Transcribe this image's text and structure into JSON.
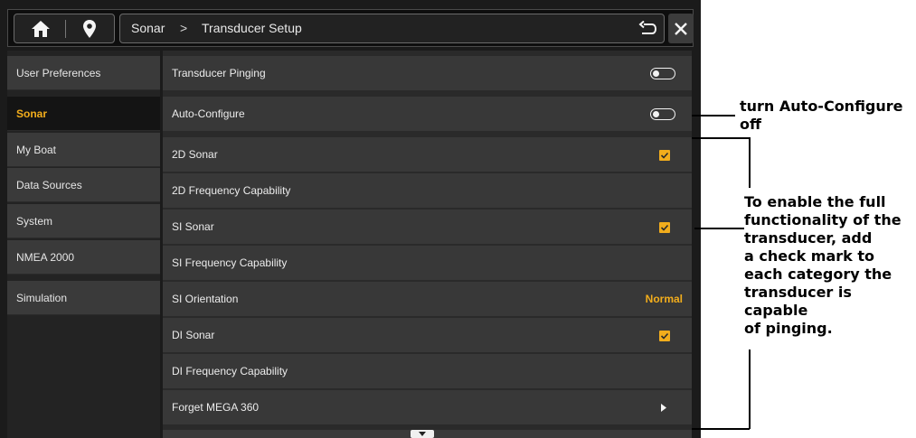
{
  "breadcrumb": {
    "root": "Sonar",
    "separator": ">",
    "current": "Transducer Setup"
  },
  "sidebar": {
    "items": [
      {
        "label": "User Preferences"
      },
      {
        "label": "Sonar",
        "selected": true
      },
      {
        "label": "My Boat"
      },
      {
        "label": "Data Sources"
      },
      {
        "label": "System"
      },
      {
        "label": "NMEA 2000"
      },
      {
        "label": "Simulation"
      }
    ]
  },
  "settings": {
    "rows": [
      {
        "label": "Transducer Pinging",
        "control": "toggle",
        "on": false
      },
      {
        "label": "Auto-Configure",
        "control": "toggle",
        "on": false
      },
      {
        "label": "2D Sonar",
        "control": "checkbox",
        "checked": true
      },
      {
        "label": "2D Frequency Capability",
        "control": "none"
      },
      {
        "label": "SI Sonar",
        "control": "checkbox",
        "checked": true
      },
      {
        "label": "SI Frequency Capability",
        "control": "none"
      },
      {
        "label": "SI Orientation",
        "control": "value",
        "value": "Normal"
      },
      {
        "label": "DI Sonar",
        "control": "checkbox",
        "checked": true
      },
      {
        "label": "DI Frequency Capability",
        "control": "none"
      },
      {
        "label": "Forget MEGA 360",
        "control": "submenu"
      }
    ]
  },
  "annotations": {
    "auto_configure_line1": "turn Auto-Configure",
    "auto_configure_line2": "off",
    "enable_lines": [
      "To enable the full",
      "functionality of the",
      "transducer, add",
      "a check mark to",
      "each category the",
      "transducer is capable",
      "of pinging."
    ]
  },
  "icons": {
    "home": "home-icon",
    "location": "map-pin-icon",
    "back": "back-arrow-icon",
    "close": "close-icon",
    "check": "checkmark-icon",
    "chevron": "chevron-right-icon",
    "scroll_down": "chevron-down-icon"
  },
  "colors": {
    "accent": "#f2ad1c",
    "background": "#1b1b1b",
    "row": "#383838",
    "text": "#ececec"
  }
}
